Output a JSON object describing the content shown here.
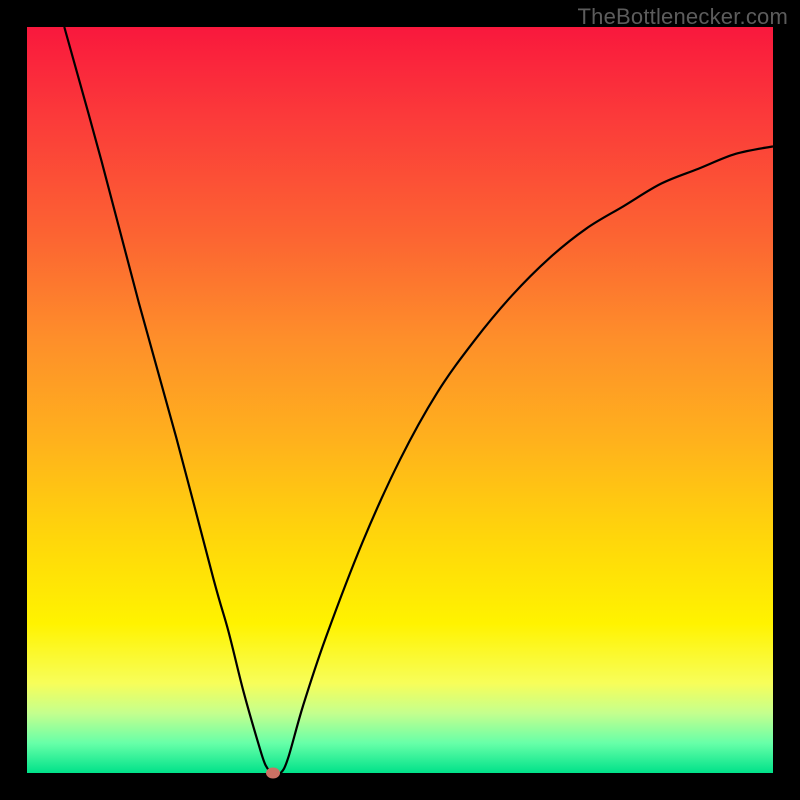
{
  "attribution": "TheBottlenecker.com",
  "colors": {
    "frame": "#000000",
    "curve": "#000000",
    "marker": "#cb7164",
    "gradient_top": "#f9183d",
    "gradient_bottom": "#00e28a"
  },
  "chart_data": {
    "type": "line",
    "title": "",
    "xlabel": "",
    "ylabel": "",
    "xlim": [
      0,
      100
    ],
    "ylim": [
      0,
      100
    ],
    "x": [
      5,
      10,
      15,
      20,
      25,
      27,
      29,
      31,
      32,
      33,
      34,
      35,
      37,
      40,
      45,
      50,
      55,
      60,
      65,
      70,
      75,
      80,
      85,
      90,
      95,
      100
    ],
    "values": [
      100,
      82,
      63,
      45,
      26,
      19,
      11,
      4,
      1,
      0,
      0,
      2,
      9,
      18,
      31,
      42,
      51,
      58,
      64,
      69,
      73,
      76,
      79,
      81,
      83,
      84
    ],
    "marker": {
      "x": 33,
      "y": 0
    },
    "annotations": []
  }
}
